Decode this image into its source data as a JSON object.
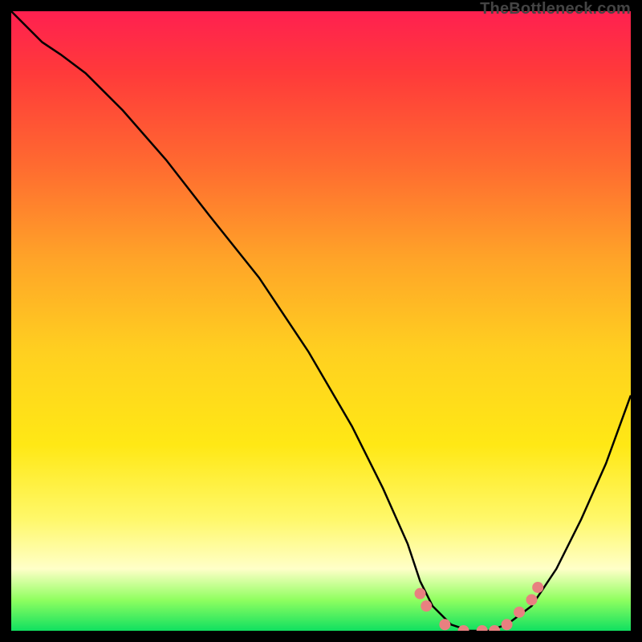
{
  "watermark": {
    "text": "TheBottleneck.com"
  },
  "colors": {
    "page_bg": "#000000",
    "curve": "#000000",
    "markers": "#e88080",
    "gradient_top": "#ff2050",
    "gradient_bottom": "#10e060"
  },
  "chart_data": {
    "type": "line",
    "title": "",
    "xlabel": "",
    "ylabel": "",
    "xlim": [
      0,
      100
    ],
    "ylim": [
      0,
      100
    ],
    "grid": false,
    "legend": false,
    "series": [
      {
        "name": "curve",
        "x": [
          0,
          5,
          8,
          12,
          18,
          25,
          32,
          40,
          48,
          55,
          60,
          64,
          66,
          68,
          71,
          74,
          77,
          80,
          84,
          88,
          92,
          96,
          100
        ],
        "y": [
          100,
          95,
          93,
          90,
          84,
          76,
          67,
          57,
          45,
          33,
          23,
          14,
          8,
          4,
          1,
          0,
          0,
          1,
          4,
          10,
          18,
          27,
          38
        ]
      }
    ],
    "markers": [
      {
        "x": 66,
        "y": 6
      },
      {
        "x": 67,
        "y": 4
      },
      {
        "x": 70,
        "y": 1
      },
      {
        "x": 73,
        "y": 0
      },
      {
        "x": 76,
        "y": 0
      },
      {
        "x": 78,
        "y": 0
      },
      {
        "x": 80,
        "y": 1
      },
      {
        "x": 82,
        "y": 3
      },
      {
        "x": 84,
        "y": 5
      },
      {
        "x": 85,
        "y": 7
      }
    ]
  }
}
